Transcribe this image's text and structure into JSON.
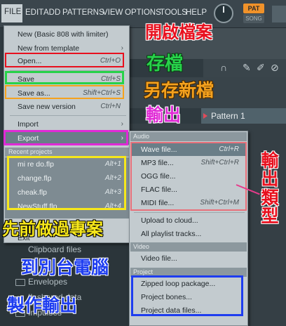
{
  "menubar": {
    "items": [
      "FILE",
      "EDIT",
      "ADD",
      "PATTERNS",
      "VIEW",
      "OPTIONS",
      "TOOLS",
      "HELP"
    ],
    "pat_label": "PAT",
    "song_label": "SONG"
  },
  "background": {
    "pattern_tab": "Pattern 1",
    "browser_items": [
      "Clipboard files",
      "Envelopes",
      "IL shared data",
      "Impulses"
    ]
  },
  "file_menu": {
    "items": [
      {
        "label": "New (Basic 808 with limiter)",
        "shortcut": ""
      },
      {
        "label": "New from template",
        "shortcut": ""
      },
      {
        "label": "Open...",
        "shortcut": "Ctrl+O"
      },
      {
        "label": "Save",
        "shortcut": "Ctrl+S"
      },
      {
        "label": "Save as...",
        "shortcut": "Shift+Ctrl+S"
      },
      {
        "label": "Save new version",
        "shortcut": "Ctrl+N"
      },
      {
        "label": "Import",
        "shortcut": ""
      },
      {
        "label": "Export",
        "shortcut": ""
      }
    ],
    "recent_header": "Recent projects",
    "recent": [
      {
        "label": "mi re do.flp",
        "shortcut": "Alt+1"
      },
      {
        "label": "change.flp",
        "shortcut": "Alt+2"
      },
      {
        "label": "cheak.flp",
        "shortcut": "Alt+3"
      },
      {
        "label": "NewStuff.flp",
        "shortcut": "Alt+4"
      }
    ],
    "exit_label": "Exit"
  },
  "export_menu": {
    "audio_header": "Audio",
    "audio": [
      {
        "label": "Wave file...",
        "shortcut": "Ctrl+R"
      },
      {
        "label": "MP3 file...",
        "shortcut": "Shift+Ctrl+R"
      },
      {
        "label": "OGG file...",
        "shortcut": ""
      },
      {
        "label": "FLAC file...",
        "shortcut": ""
      },
      {
        "label": "MIDI file...",
        "shortcut": "Shift+Ctrl+M"
      }
    ],
    "upload": "Upload to cloud...",
    "playlist": "All playlist tracks...",
    "video_header": "Video",
    "video_item": "Video file...",
    "project_header": "Project",
    "project": [
      "Zipped loop package...",
      "Project bones...",
      "Project data files..."
    ]
  },
  "annotations": {
    "open": "開啟檔案",
    "save": "存檔",
    "save_as": "另存新檔",
    "export": "輸出",
    "export_types": "輸出類型",
    "recent": "先前做過專案",
    "other_pc_1": "到別台電腦",
    "other_pc_2": "製作輸出"
  },
  "colors": {
    "red": "#e8101e",
    "green": "#27d24a",
    "orange": "#f5a21e",
    "magenta": "#e02ad6",
    "yellow": "#f6e71b",
    "blue": "#1e3df0"
  }
}
